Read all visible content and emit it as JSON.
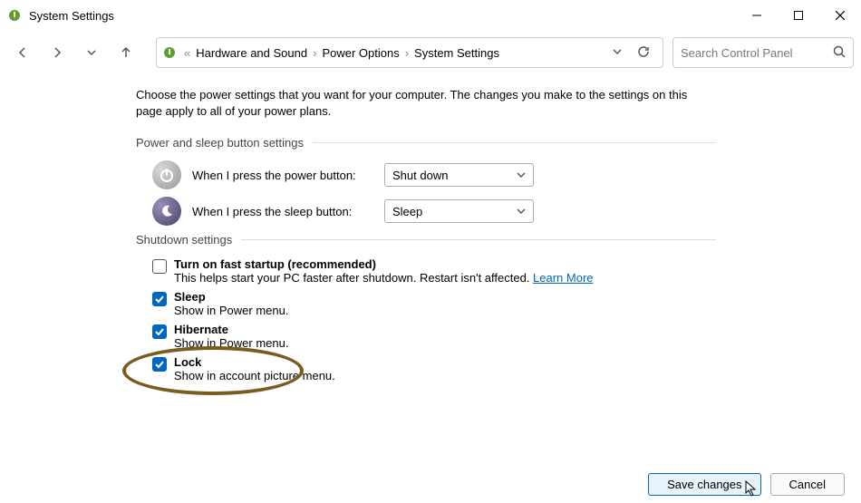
{
  "window": {
    "title": "System Settings"
  },
  "breadcrumb": {
    "root_sep": "«",
    "items": [
      "Hardware and Sound",
      "Power Options",
      "System Settings"
    ]
  },
  "search": {
    "placeholder": "Search Control Panel"
  },
  "intro": "Choose the power settings that you want for your computer. The changes you make to the settings on this page apply to all of your power plans.",
  "sections": {
    "buttons": {
      "title": "Power and sleep button settings",
      "power_label": "When I press the power button:",
      "power_value": "Shut down",
      "sleep_label": "When I press the sleep button:",
      "sleep_value": "Sleep"
    },
    "shutdown": {
      "title": "Shutdown settings",
      "fast": {
        "label": "Turn on fast startup (recommended)",
        "desc": "This helps start your PC faster after shutdown. Restart isn't affected. ",
        "link": "Learn More"
      },
      "sleep": {
        "label": "Sleep",
        "desc": "Show in Power menu."
      },
      "hibernate": {
        "label": "Hibernate",
        "desc": "Show in Power menu."
      },
      "lock": {
        "label": "Lock",
        "desc": "Show in account picture menu."
      }
    }
  },
  "buttons": {
    "save": "Save changes",
    "cancel": "Cancel"
  }
}
